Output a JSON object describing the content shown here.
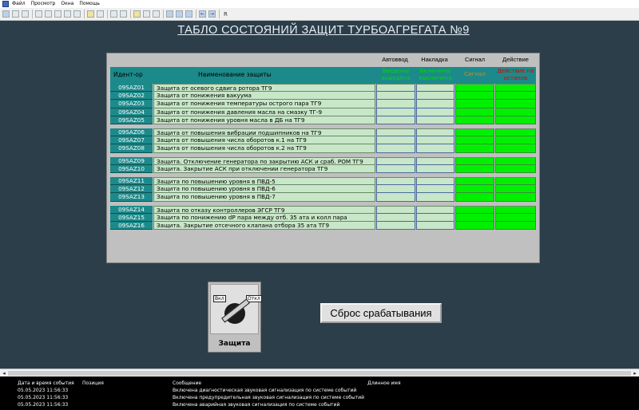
{
  "menu": [
    "Файл",
    "Просмотр",
    "Окна",
    "Помощь"
  ],
  "toolbar": {
    "last_label": "R"
  },
  "title": "ТАБЛО СОСТОЯНИЙ ЗАЩИТ ТУРБОАГРЕГАТА №9",
  "panel": {
    "col_autovvod": "Автоввод",
    "col_nakladka": "Накладка",
    "col_signal": "Сигнал",
    "col_deistvie": "Действие",
    "hdr_id": "Идент-ор",
    "hdr_name": "Наименование защиты",
    "sub_autovvod": "Введена/ выведена",
    "sub_nakladka": "Включена/ выключена",
    "sub_signal": "Сигнал",
    "sub_deistvie": "Действие на останов",
    "groups": [
      [
        {
          "id": "09SAZ01",
          "name": "Защита от осевого сдвига ротора ТГ9"
        },
        {
          "id": "09SAZ02",
          "name": "Защита от понижения вакуума"
        },
        {
          "id": "09SAZ03",
          "name": "Защита от понижения температуры острого пара ТГ9"
        },
        {
          "id": "09SAZ04",
          "name": "Защита от понижения давления масла на смазку ТГ-9"
        },
        {
          "id": "09SAZ05",
          "name": "Защита от понижения уровня масла в ДБ на ТГ9"
        }
      ],
      [
        {
          "id": "09SAZ06",
          "name": "Защита от повышения вибрации подшипников на ТГ9"
        },
        {
          "id": "09SAZ07",
          "name": "Защита от повышения числа оборотов к.1 на ТГ9"
        },
        {
          "id": "09SAZ08",
          "name": "Защита от повышения числа оборотов к.2 на ТГ9"
        }
      ],
      [
        {
          "id": "09SAZ09",
          "name": "Защита. Отключение генератора по закрытию АСК и сраб. РОМ ТГ9"
        },
        {
          "id": "09SAZ10",
          "name": "Защита. Закрытие АСК при отключении генератора ТГ9"
        }
      ],
      [
        {
          "id": "09SAZ11",
          "name": "Защита по повышению уровня в ПВД-5"
        },
        {
          "id": "09SAZ12",
          "name": "Защита по повышению уровня в ПВД-6"
        },
        {
          "id": "09SAZ13",
          "name": "Защита по повышению уровня в ПВД-7"
        }
      ],
      [
        {
          "id": "09SAZ14",
          "name": "Защита по отказу контроллеров ЭГСР ТГ9"
        },
        {
          "id": "09SAZ15",
          "name": "Защита по понижению dP пара между отб. 35 ата и колл пара"
        },
        {
          "id": "09SAZ16",
          "name": "Защита. Закрытие отсечного клапана отбора 35 ата ТГ9"
        }
      ]
    ]
  },
  "switch": {
    "on_label": "Вкл",
    "off_label": "Откл",
    "caption": "Защита"
  },
  "reset_button": "Сброс срабатывания",
  "log": {
    "headers": [
      "Дата и время события",
      "Позиция",
      "Сообщение",
      "Длинное имя"
    ],
    "rows": [
      {
        "time": "05.05.2023 11:56:33",
        "message": "Включена диагностическая звуковая сигнализация по системе событий"
      },
      {
        "time": "05.05.2023 11:56:33",
        "message": "Включена предупредительная звуковая сигнализация по системе событий"
      },
      {
        "time": "05.05.2023 11:56:33",
        "message": "Включена аварийная звуковая сигнализация по системе событий"
      }
    ]
  },
  "colors": {
    "background": "#2c3e4a",
    "teal": "#1c8a8a",
    "green": "#00f000",
    "row_name": "#c8e6c8",
    "header_green": "#00d800",
    "header_orange": "#f08000",
    "header_red": "#e00000"
  }
}
